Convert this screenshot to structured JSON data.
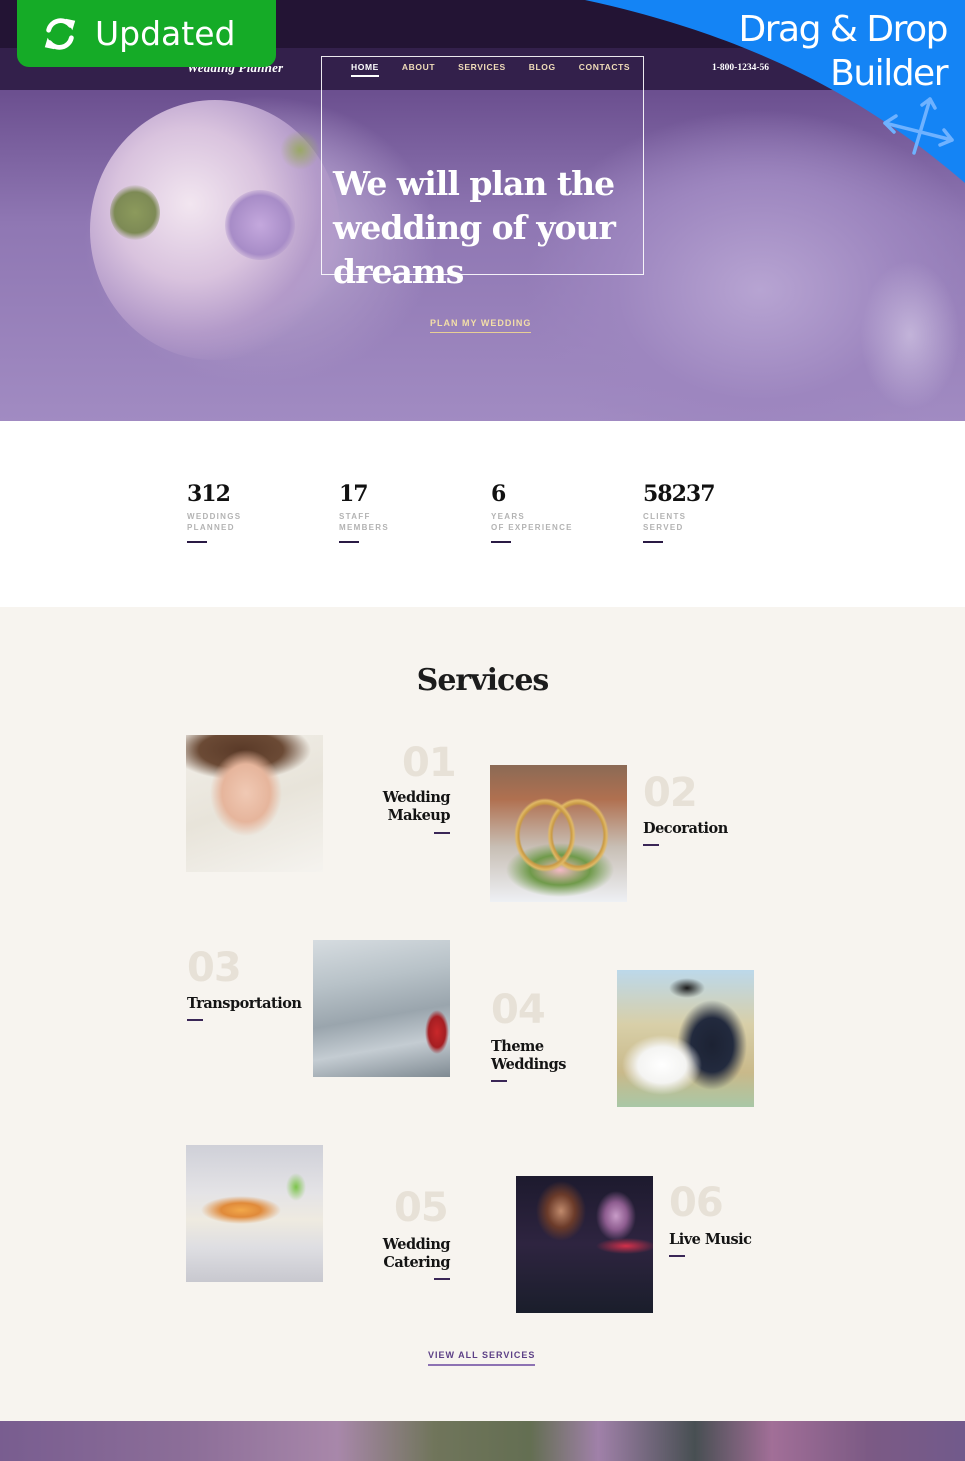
{
  "header": {
    "logo": "Wedding Planner",
    "nav": [
      {
        "label": "HOME",
        "active": true
      },
      {
        "label": "ABOUT",
        "active": false
      },
      {
        "label": "SERVICES",
        "active": false
      },
      {
        "label": "BLOG",
        "active": false
      },
      {
        "label": "CONTACTS",
        "active": false
      }
    ],
    "phone": "1-800-1234-56"
  },
  "hero": {
    "title": "We will plan the wedding of your dreams",
    "cta": "PLAN MY WEDDING"
  },
  "stats": [
    {
      "value": "312",
      "label": "WEDDINGS\nPLANNED"
    },
    {
      "value": "17",
      "label": "STAFF\nMEMBERS"
    },
    {
      "value": "6",
      "label": "YEARS\nOF EXPERIENCE"
    },
    {
      "value": "58237",
      "label": "CLIENTS\nSERVED"
    }
  ],
  "services": {
    "title": "Services",
    "items": [
      {
        "num": "01",
        "name": "Wedding\nMakeup",
        "image": "bride-portrait"
      },
      {
        "num": "02",
        "name": "Decoration",
        "image": "wedding-rings-flowers"
      },
      {
        "num": "03",
        "name": "Transportation",
        "image": "white-limousine"
      },
      {
        "num": "04",
        "name": "Theme\nWeddings",
        "image": "couple-in-vintage-car"
      },
      {
        "num": "05",
        "name": "Wedding\nCatering",
        "image": "banquet-table"
      },
      {
        "num": "06",
        "name": "Live Music",
        "image": "band-musicians"
      }
    ],
    "view_all": "VIEW ALL SERVICES"
  },
  "badges": {
    "updated": "Updated",
    "drag_drop_line1": "Drag & Drop",
    "drag_drop_line2": "Builder"
  },
  "colors": {
    "header_bg": "#33204b",
    "accent_purple": "#5c3f86",
    "gold": "#f3dfa8",
    "updated_green": "#15ab27",
    "banner_blue": "#1484f5",
    "page_bg": "#f7f4ef"
  }
}
